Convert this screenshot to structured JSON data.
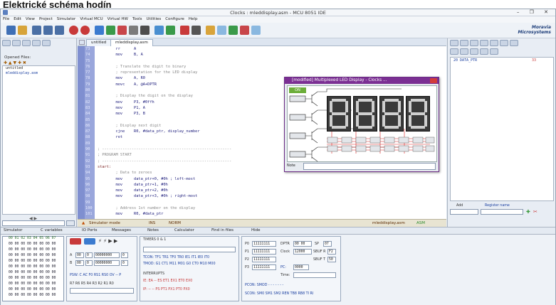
{
  "heading": "Elektrické schéma hodín",
  "window": {
    "title": "Clocks : mleddisplay.asm - MCU 8051 IDE",
    "controls": "– ❐ ✕"
  },
  "menu": [
    "File",
    "Edit",
    "View",
    "Project",
    "Simulator",
    "Virtual MCU",
    "Virtual HW",
    "Tools",
    "Utilities",
    "Configure",
    "Help"
  ],
  "logo": {
    "line1": "Moravia",
    "line2": "Microsystems"
  },
  "left_panel": {
    "opened_files_label": "Opened Files:",
    "files": [
      "untitled",
      "mleddisplay.asm"
    ]
  },
  "editor": {
    "tabs": [
      "untitled",
      "mleddisplay.asm"
    ],
    "line_numbers": [
      "73",
      "74",
      "75",
      "76",
      "77",
      "78",
      "79",
      "80",
      "81",
      "82",
      "83",
      "84",
      "85",
      "86",
      "87",
      "88",
      "89",
      "90",
      "91",
      "92",
      "93",
      "94",
      "95",
      "96",
      "97",
      "98",
      "99",
      "100",
      "101"
    ],
    "lines": [
      {
        "t": "        rr      A",
        "c": "kw"
      },
      {
        "t": "        mov     B, A",
        "c": "kw"
      },
      {
        "t": "",
        "c": ""
      },
      {
        "t": "        ; Translate the digit to binary",
        "c": "cm"
      },
      {
        "t": "        ; representation for the LED display",
        "c": "cm"
      },
      {
        "t": "        mov     A, R0",
        "c": "kw"
      },
      {
        "t": "        movc    A, @A+DPTR",
        "c": "kw"
      },
      {
        "t": "",
        "c": ""
      },
      {
        "t": "        ; Display the digit on the display",
        "c": "cm"
      },
      {
        "t": "        mov     P3, #0ffh",
        "c": "kw"
      },
      {
        "t": "        mov     P1, A",
        "c": "kw"
      },
      {
        "t": "        mov     P3, B",
        "c": "kw"
      },
      {
        "t": "",
        "c": ""
      },
      {
        "t": "        ; Display next digit",
        "c": "cm"
      },
      {
        "t": "        cjne    R0, #data_ptr, display_number",
        "c": "kw"
      },
      {
        "t": "        ret",
        "c": "kw"
      },
      {
        "t": "",
        "c": ""
      },
      {
        "t": "; ---------------------------------------------------------",
        "c": "cm"
      },
      {
        "t": "; PROGRAM START",
        "c": "cm"
      },
      {
        "t": "; ---------------------------------------------------------",
        "c": "cm"
      },
      {
        "t": "start:",
        "c": "lb"
      },
      {
        "t": "        ; Data to zeroes",
        "c": "cm"
      },
      {
        "t": "        mov     data_ptr+0, #0h ; left-most",
        "c": "kw"
      },
      {
        "t": "        mov     data_ptr+1, #0h",
        "c": "kw"
      },
      {
        "t": "        mov     data_ptr+2, #0h",
        "c": "kw"
      },
      {
        "t": "        mov     data_ptr+3, #0h ; right-most",
        "c": "kw"
      },
      {
        "t": "",
        "c": ""
      },
      {
        "t": "        ; Address 1st number on the display",
        "c": "cm"
      },
      {
        "t": "        mov     R0, #data_ptr",
        "c": "kw"
      }
    ],
    "status": {
      "mode": "Simulator mode",
      "ins": "INS",
      "nrm": "NORM",
      "file": "mleddisplay.asm",
      "type": "ASM"
    }
  },
  "right_panel": {
    "entry": "20  DATA_PTR",
    "entry_val": "33",
    "add_label": "Add",
    "register_name_label": "Register name"
  },
  "simulator_window": {
    "title": "[modified] Multiplexed LED Display - Clocks ...",
    "on_label": "ON",
    "note_label": "Note"
  },
  "bottom_tabs": [
    "Simulator",
    "C variables",
    "IO Ports",
    "Messages",
    "Notes",
    "Calculator",
    "Find in files",
    "Hide"
  ],
  "sim_panel": {
    "hex_header": "  00 01 02 03 04 05 06 07",
    "hex_rows": [
      "00 00 00 00 00 00 00 00",
      "00 00 00 00 00 00 00 00",
      "00 00 00 00 00 00 00 00",
      "00 00 00 00 00 00 00 00",
      "00 00 00 00 00 00 00 00",
      "00 00 00 00 00 00 00 00",
      "00 00 00 00 00 00 00 00",
      "00 00 00 00 00 00 00 00",
      "00 00 00 00 00 00 00 00",
      "00 00 00 00 00 00 00 00"
    ],
    "reg_a_label": "A",
    "reg_a_hex": "00",
    "reg_a_dec": "0",
    "reg_a_bin": "00000000",
    "reg_a_oct": "0",
    "reg_b_label": "B",
    "reg_b_hex": "00",
    "reg_b_dec": "0",
    "reg_b_bin": "00000000",
    "reg_b_oct": "0",
    "psw_label": "PSW: C AC F0 RS1 RS0 OV -- P",
    "regs_label": "R7 R6 R5 R4 R3 R2 R1 R0",
    "timers_label": "TIMERS 0 & 1",
    "tcon_label": "TCON: TF1 TR1 TF0 TR0 IE1 IT1 IE0 IT0",
    "tmod_label": "TMOD: G1 CT1 M11 M01 G0 CT0 M10 M00",
    "interrupts_label": "INTERRUPTS",
    "ie_label": "IE: EA -- ES ET1 EX1 ET0 EX0",
    "ip_label": "IP: -- -- PS PT1 PX1 PT0 PX0",
    "p0": "11111111",
    "p1": "11111111",
    "p2": "11111111",
    "p3": "11111111",
    "dptr_label": "DPTR",
    "dptr": "00 00",
    "sp_label": "SP",
    "sp": "07",
    "clock_label": "Clock",
    "clock": "12000",
    "sbufr_label": "SBUF R",
    "sbufr": "F2",
    "sbuft_label": "SBUF T",
    "sbuft": "50",
    "pc_label": "PC:",
    "pc": "0000",
    "time_label": "Time:",
    "pcon_label": "PCON: SMOD - - - - - - -",
    "scon_label": "SCON: SM0 SM1 SM2 REN TB8 RB8 TI RI"
  },
  "colors": {
    "accent": "#7b2f93",
    "gutter": "#7f8fd0",
    "editor_status": "#e8e4d2"
  }
}
